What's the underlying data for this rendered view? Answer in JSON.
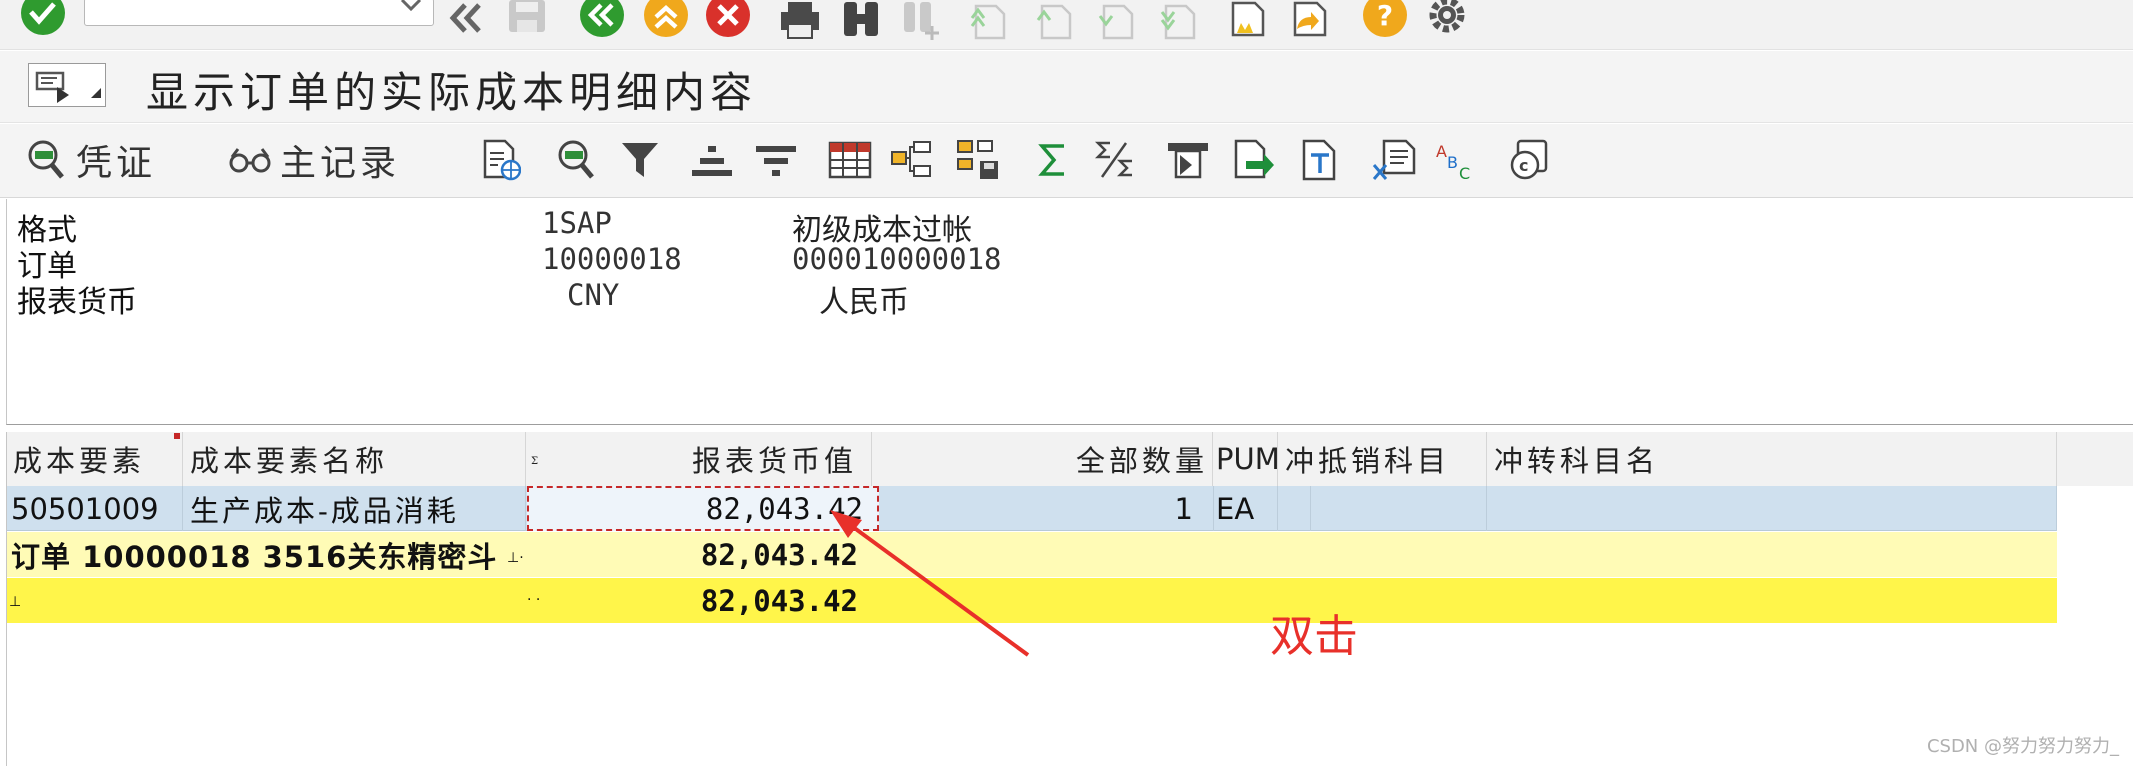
{
  "system_toolbar": {
    "command_value": "",
    "icons": [
      "enter-check-icon",
      "command-field-dropdown-icon",
      "collapse-toolbar-icon",
      "save-icon",
      "back-icon",
      "exit-icon",
      "cancel-icon",
      "print-icon",
      "find-icon",
      "find-next-icon",
      "first-page-icon",
      "previous-page-icon",
      "next-page-icon",
      "last-page-icon",
      "create-session-icon",
      "shortcut-icon",
      "help-icon",
      "settings-gear-icon"
    ]
  },
  "title_bar": {
    "title": "显示订单的实际成本明细内容"
  },
  "app_toolbar": {
    "voucher_label": "凭证",
    "master_record_label": "主记录"
  },
  "header": {
    "rows": [
      {
        "label": "格式",
        "value": "1SAP",
        "desc": "初级成本过帐"
      },
      {
        "label": "订单",
        "value": "10000018",
        "desc": "000010000018"
      },
      {
        "label": "报表货币",
        "value": "CNY",
        "desc": "人民币"
      }
    ]
  },
  "grid": {
    "columns": {
      "cost_element": "成本要素",
      "cost_element_name": "成本要素名称",
      "report_value": "报表货币值",
      "total_quantity": "全部数量",
      "pum": "PUM",
      "offset_account": "冲抵销科目",
      "offset_account_name": "冲转科目名"
    },
    "rows": [
      {
        "cost_element": "50501009",
        "cost_element_name": "生产成本-成品消耗",
        "report_value": "82,043.42",
        "total_quantity": "1",
        "pum": "EA"
      }
    ],
    "subtotal": {
      "label": "订单  10000018 3516关东精密斗",
      "value": "82,043.42"
    },
    "total": {
      "value": "82,043.42"
    }
  },
  "annotation": {
    "text": "双击",
    "color": "#e8302a"
  },
  "watermark": "CSDN @努力努力努力_"
}
